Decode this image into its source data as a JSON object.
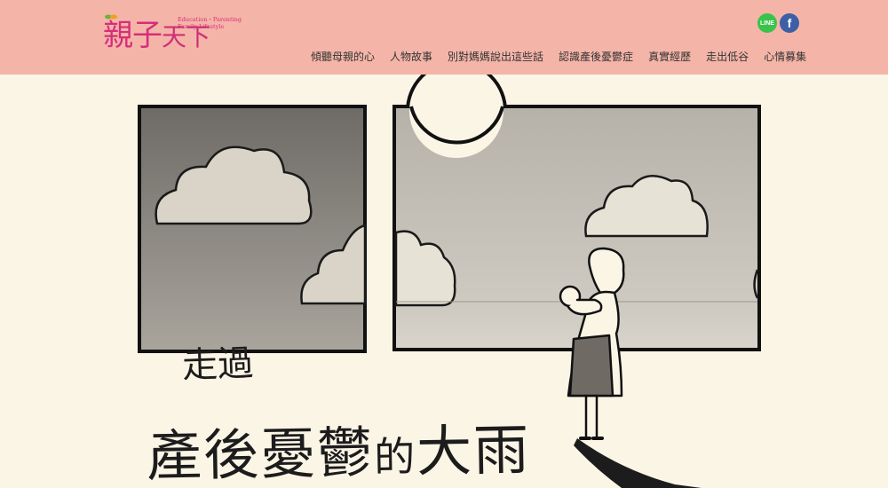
{
  "header": {
    "logo_cn_main": "親子",
    "logo_cn_sub": "天下",
    "logo_en_line1": "Education・Parenting",
    "logo_en_line2": "Family Lifestyle"
  },
  "social": {
    "line_label": "LINE",
    "facebook_label": "f"
  },
  "nav": {
    "items": [
      {
        "label": "傾聽母親的心"
      },
      {
        "label": "人物故事"
      },
      {
        "label": "別對媽媽說出這些話"
      },
      {
        "label": "認識產後憂鬱症"
      },
      {
        "label": "真實經歷"
      },
      {
        "label": "走出低谷"
      },
      {
        "label": "心情募集"
      }
    ]
  },
  "hero": {
    "title_line1": "走過",
    "title_line2_a": "產後憂鬱",
    "title_line2_b": "的",
    "title_line2_c": "大雨"
  },
  "colors": {
    "header_bg": "#f4b5a8",
    "page_bg": "#fbf5e6",
    "logo": "#d62e7a",
    "line_green": "#3ac34a",
    "facebook_blue": "#3e5fa6"
  }
}
